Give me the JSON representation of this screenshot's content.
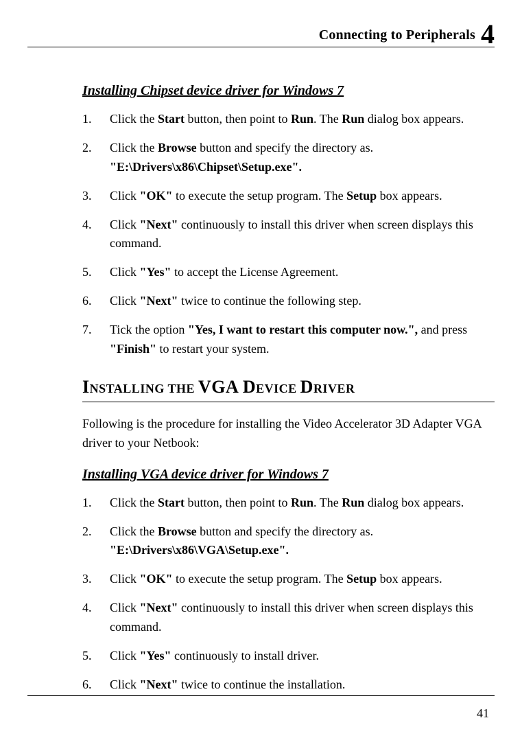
{
  "header": {
    "title": "Connecting to Peripherals",
    "chapter": "4"
  },
  "sectionA": {
    "title": "Installing Chipset device driver for Windows 7",
    "steps": [
      {
        "n": "1.",
        "pre": "Click the ",
        "b1": "Start",
        "mid1": " button, then point to ",
        "b2": "Run",
        "mid2": ". The ",
        "b3": "Run",
        "post": " dialog box appears."
      },
      {
        "n": "2.",
        "pre": "Click the ",
        "b1": "Browse",
        "post": " button and specify the directory as.",
        "line2": "\"E:\\Drivers\\x86\\Chipset\\Setup.exe\"."
      },
      {
        "n": "3.",
        "pre": "Click ",
        "b1": "\"OK\"",
        "mid1": " to execute the setup program. The ",
        "b2": "Setup",
        "post": " box appears."
      },
      {
        "n": "4.",
        "pre": "Click ",
        "b1": "\"Next\"",
        "post": " continuously to install this driver when screen displays this command."
      },
      {
        "n": "5.",
        "pre": "Click ",
        "b1": "\"Yes\"",
        "post": " to accept the License Agreement."
      },
      {
        "n": "6.",
        "pre": "Click ",
        "b1": "\"Next\"",
        "post": " twice to continue the following step."
      },
      {
        "n": "7.",
        "pre": "Tick the option ",
        "b1": "\"Yes, I want to restart this computer now.\", ",
        "mid1": "and press ",
        "b2": "\"Finish\"",
        "post": " to restart your system."
      }
    ]
  },
  "bigSection": {
    "w1": "I",
    "r1": "NSTALLING THE ",
    "w2": "VGA D",
    "r2": "EVICE ",
    "w3": "D",
    "r3": "RIVER"
  },
  "introPara": "Following is the procedure for installing the Video Accelerator 3D Adapter VGA driver to your Netbook:",
  "sectionB": {
    "title": "Installing VGA device driver for Windows 7",
    "steps": [
      {
        "n": "1.",
        "pre": "Click the ",
        "b1": "Start",
        "mid1": " button, then point to ",
        "b2": "Run",
        "mid2": ". The ",
        "b3": "Run",
        "post": " dialog box appears."
      },
      {
        "n": "2.",
        "pre": "Click the ",
        "b1": "Browse",
        "post": " button and specify the directory as.",
        "line2": "\"E:\\Drivers\\x86\\VGA\\Setup.exe\"."
      },
      {
        "n": "3.",
        "pre": "Click ",
        "b1": "\"OK\"",
        "mid1": " to execute the setup program. The ",
        "b2": "Setup",
        "post": " box appears."
      },
      {
        "n": "4.",
        "pre": "Click ",
        "b1": "\"Next\"",
        "post": " continuously to install this driver when screen displays this command."
      },
      {
        "n": "5.",
        "pre": "Click ",
        "b1": "\"Yes\"",
        "post": " continuously to install driver."
      },
      {
        "n": "6.",
        "pre": "Click ",
        "b1": "\"Next\"",
        "post": " twice to continue the installation."
      }
    ]
  },
  "pageNumber": "41"
}
